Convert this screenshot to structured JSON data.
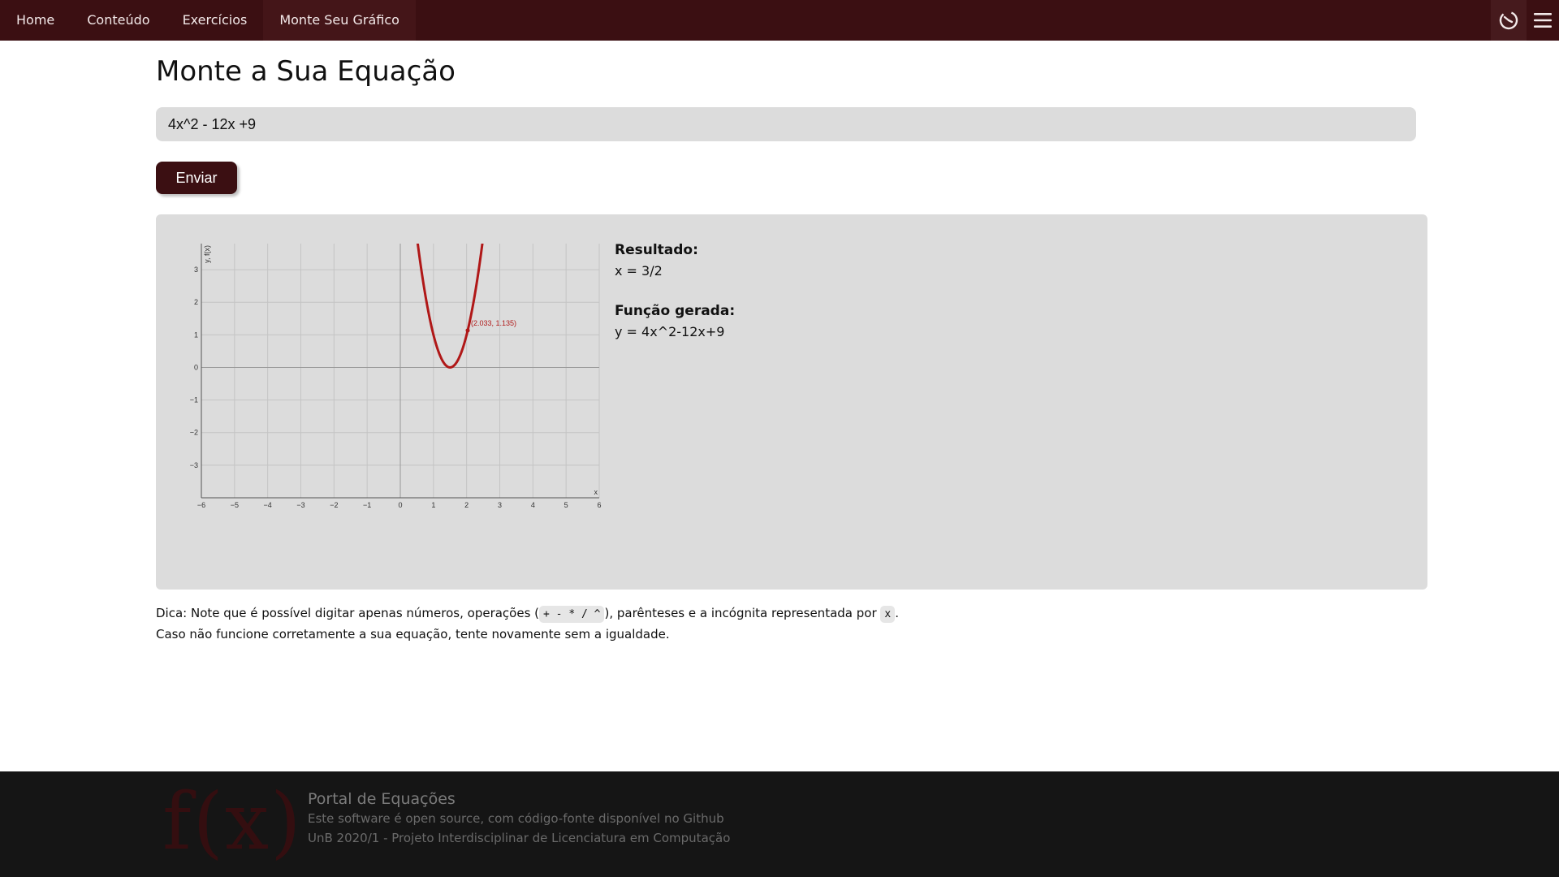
{
  "nav": {
    "items": [
      {
        "label": "Home"
      },
      {
        "label": "Conteúdo"
      },
      {
        "label": "Exercícios"
      },
      {
        "label": "Monte Seu Gráfico"
      }
    ],
    "icons": [
      "history-icon",
      "menu-icon"
    ]
  },
  "main": {
    "title": "Monte a Sua Equação",
    "equation_value": "4x^2 - 12x +9",
    "send_label": "Enviar"
  },
  "result": {
    "result_heading": "Resultado:",
    "result_value": "x = 3/2",
    "function_heading": "Função gerada:",
    "function_value": "y = 4x^2-12x+9"
  },
  "chart_data": {
    "type": "line",
    "function": "4x^2-12x+9",
    "xlabel": "x",
    "ylabel": "y, f(x)",
    "xlim": [
      -6,
      6
    ],
    "ylim": [
      -4,
      3.8
    ],
    "xticks": [
      -6,
      -5,
      -4,
      -3,
      -2,
      -1,
      0,
      1,
      2,
      3,
      4,
      5,
      6
    ],
    "yticks": [
      -3,
      -2,
      -1,
      0,
      1,
      2,
      3
    ],
    "grid": true,
    "series_color": "#b01818",
    "highlight_point": {
      "x": 2.033,
      "y": 1.135,
      "label": "(2.033, 1.135)"
    }
  },
  "tip": {
    "prefix": "Dica: Note que é possível digitar apenas números, operações (",
    "ops": "+ - * / ^",
    "middle": "), parênteses e a incógnita representada por ",
    "var": "x",
    "suffix": ".",
    "line2": "Caso não funcione corretamente a sua equação, tente novamente sem a igualdade."
  },
  "footer": {
    "logo": "f(x)",
    "title": "Portal de Equações",
    "line1": "Este software é open source, com código-fonte disponível no Github",
    "line2": "UnB 2020/1 - Projeto Interdisciplinar de Licenciatura em Computação"
  },
  "colors": {
    "brand": "#3b0f12",
    "panel": "#dcdcdc",
    "curve": "#b01818"
  }
}
